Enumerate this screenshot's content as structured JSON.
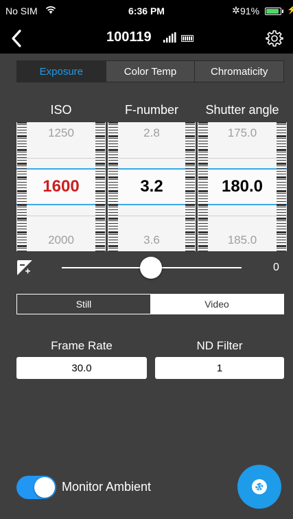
{
  "status_bar": {
    "carrier": "No SIM",
    "time": "6:36 PM",
    "battery_pct": "91%",
    "icons": [
      "wifi-icon",
      "bluetooth-icon",
      "battery-icon",
      "charging-icon"
    ]
  },
  "nav": {
    "title": "100119",
    "icons": [
      "back-chevron-icon",
      "signal-bars-icon",
      "battery-level-icon",
      "settings-gear-icon"
    ]
  },
  "tabs": [
    {
      "label": "Exposure",
      "active": true
    },
    {
      "label": "Color Temp",
      "active": false
    },
    {
      "label": "Chromaticity",
      "active": false
    }
  ],
  "pickers": [
    {
      "header": "ISO",
      "prev": "1250",
      "current": "1600",
      "next": "2000",
      "highlight": "red"
    },
    {
      "header": "F-number",
      "prev": "2.8",
      "current": "3.2",
      "next": "3.6",
      "highlight": "black"
    },
    {
      "header": "Shutter angle",
      "prev": "175.0",
      "current": "180.0",
      "next": "185.0",
      "highlight": "black"
    }
  ],
  "exposure_comp": {
    "value": "0",
    "icon": "exposure-compensation-icon"
  },
  "mode": {
    "still": "Still",
    "video": "Video",
    "selected": "Still"
  },
  "fields": {
    "frame_rate": {
      "label": "Frame Rate",
      "value": "30.0"
    },
    "nd_filter": {
      "label": "ND Filter",
      "value": "1"
    }
  },
  "monitor": {
    "label": "Monitor Ambient",
    "on": true
  },
  "colors": {
    "accent": "#1e9be9",
    "iso_value": "#cc1f1f",
    "background": "#3f3f3f"
  }
}
